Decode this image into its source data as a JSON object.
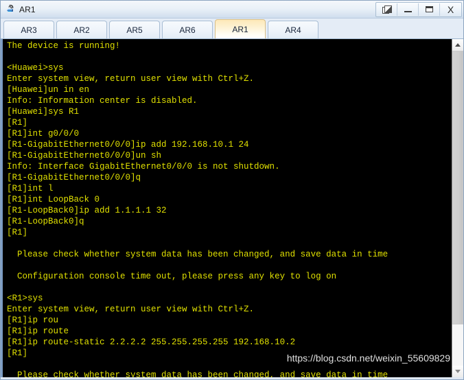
{
  "window": {
    "title": "AR1",
    "icon": "router-icon",
    "controls": [
      {
        "name": "restore-windows-button",
        "icon": "cascade-windows-icon",
        "label": ""
      },
      {
        "name": "minimize-button",
        "icon": "minimize-icon",
        "label": ""
      },
      {
        "name": "maximize-button",
        "icon": "maximize-icon",
        "label": ""
      },
      {
        "name": "close-button",
        "icon": "close-icon",
        "label": "X"
      }
    ]
  },
  "tabs": {
    "items": [
      {
        "label": "AR3",
        "selected": false
      },
      {
        "label": "AR2",
        "selected": false
      },
      {
        "label": "AR5",
        "selected": false
      },
      {
        "label": "AR6",
        "selected": false
      },
      {
        "label": "AR1",
        "selected": true
      },
      {
        "label": "AR4",
        "selected": false
      }
    ]
  },
  "console": {
    "text_color": "#e0e000",
    "background_color": "#000000",
    "lines": [
      "The device is running!",
      "",
      "<Huawei>sys",
      "Enter system view, return user view with Ctrl+Z.",
      "[Huawei]un in en",
      "Info: Information center is disabled.",
      "[Huawei]sys R1",
      "[R1]",
      "[R1]int g0/0/0",
      "[R1-GigabitEthernet0/0/0]ip add 192.168.10.1 24",
      "[R1-GigabitEthernet0/0/0]un sh",
      "Info: Interface GigabitEthernet0/0/0 is not shutdown.",
      "[R1-GigabitEthernet0/0/0]q",
      "[R1]int l",
      "[R1]int LoopBack 0",
      "[R1-LoopBack0]ip add 1.1.1.1 32",
      "[R1-LoopBack0]q",
      "[R1]",
      "",
      "  Please check whether system data has been changed, and save data in time",
      "",
      "  Configuration console time out, please press any key to log on",
      "",
      "<R1>sys",
      "Enter system view, return user view with Ctrl+Z.",
      "[R1]ip rou",
      "[R1]ip route",
      "[R1]ip route-static 2.2.2.2 255.255.255.255 192.168.10.2",
      "[R1]",
      "",
      "  Please check whether system data has been changed, and save data in time"
    ]
  },
  "watermark": {
    "text": "https://blog.csdn.net/weixin_55609829"
  },
  "scrollbar": {
    "up_arrow": "chevron-up-icon",
    "down_arrow": "chevron-down-icon"
  }
}
